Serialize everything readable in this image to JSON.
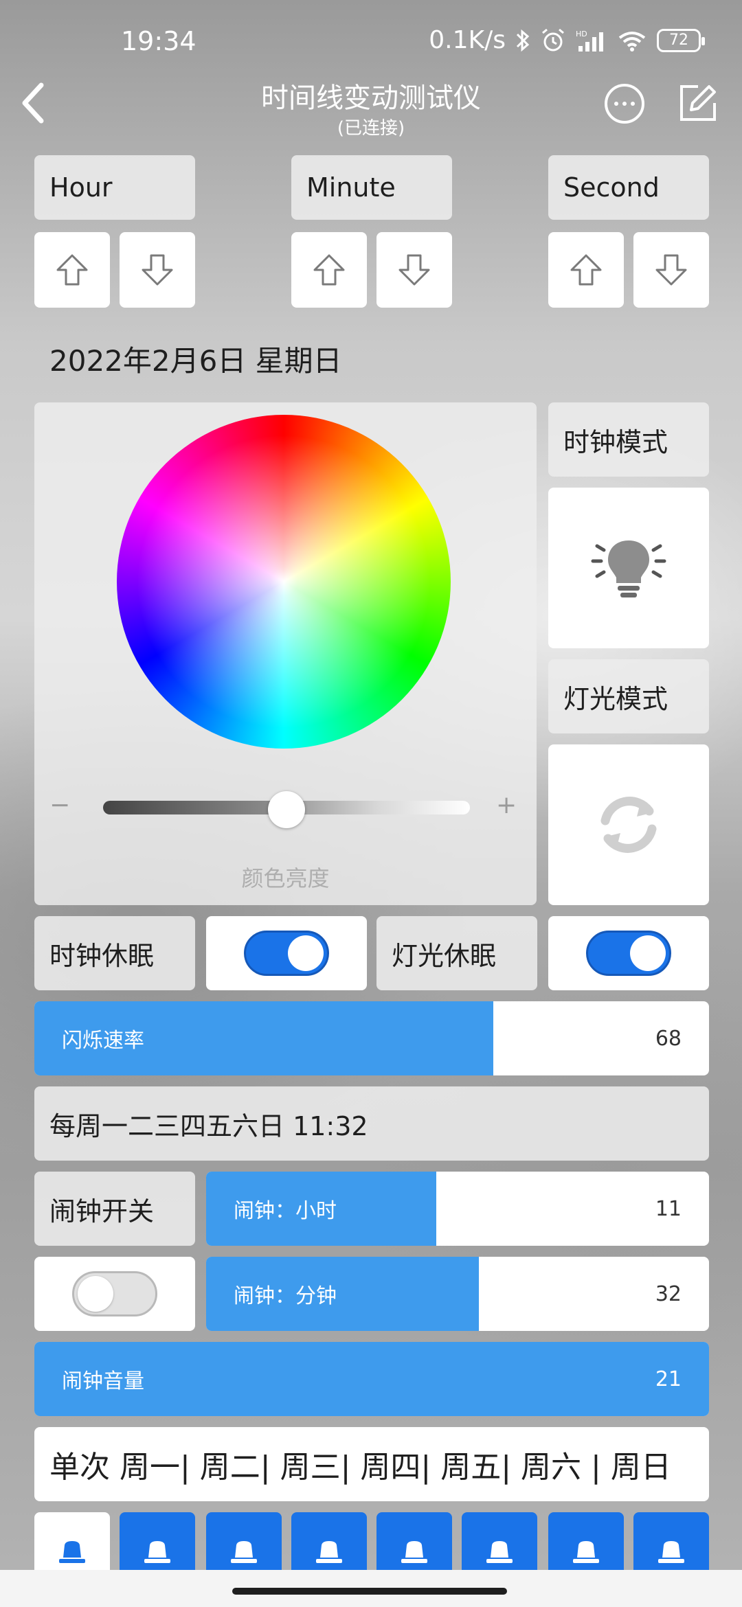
{
  "status_bar": {
    "time": "19:34",
    "network_speed": "0.1K/s",
    "battery": "72",
    "hd_label": "HD"
  },
  "header": {
    "title": "时间线变动测试仪",
    "subtitle": "(已连接)"
  },
  "time_adjust": {
    "hour_label": "Hour",
    "minute_label": "Minute",
    "second_label": "Second"
  },
  "date_text": "2022年2月6日 星期日",
  "color_picker": {
    "brightness_label": "颜色亮度",
    "brightness_fraction": 0.5,
    "minus": "−",
    "plus": "+"
  },
  "modes": {
    "clock_mode_label": "时钟模式",
    "light_mode_label": "灯光模式"
  },
  "sleep": {
    "clock_sleep_label": "时钟休眠",
    "clock_sleep_on": true,
    "light_sleep_label": "灯光休眠",
    "light_sleep_on": true
  },
  "blink_rate": {
    "label": "闪烁速率",
    "value": "68",
    "fraction": 0.68
  },
  "alarm_summary": "每周一二三四五六日 11:32",
  "alarm": {
    "switch_label": "闹钟开关",
    "switch_on": false,
    "hour_label": "闹钟：小时",
    "hour_value": "11",
    "hour_fraction": 0.458,
    "minute_label": "闹钟：分钟",
    "minute_value": "32",
    "minute_fraction": 0.542,
    "volume_label": "闹钟音量",
    "volume_value": "21",
    "volume_fraction": 1.0
  },
  "repeat_text": "单次 周一| 周二| 周三| 周四| 周五| 周六 | 周日",
  "colors": {
    "accent": "#1a73e8",
    "bar_fill": "#3e9bed"
  },
  "icons": [
    "back-arrow-icon",
    "more-icon",
    "edit-icon",
    "up-arrow-icon",
    "down-arrow-icon",
    "lightbulb-icon",
    "refresh-icon",
    "alarm-light-icon"
  ]
}
